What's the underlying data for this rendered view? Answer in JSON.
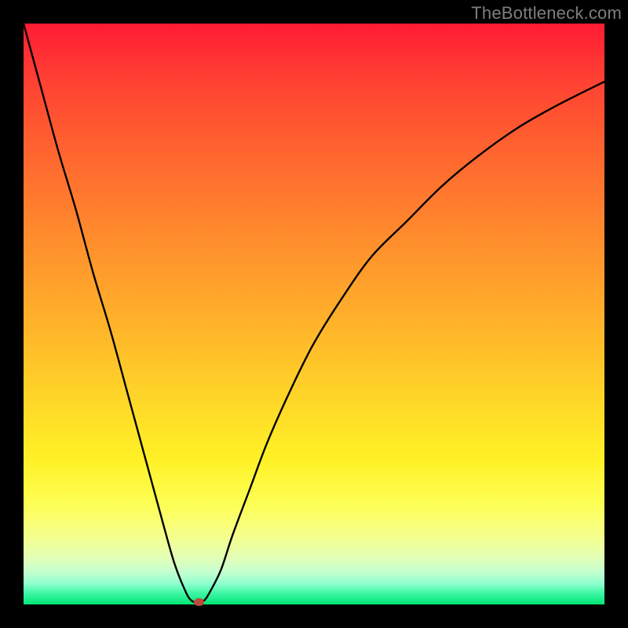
{
  "watermark": "TheBottleneck.com",
  "colors": {
    "frame": "#000000",
    "curve": "#000000",
    "marker": "#c0483f",
    "gradient_top": "#ff1b33",
    "gradient_bottom": "#00e676"
  },
  "chart_data": {
    "type": "line",
    "title": "",
    "xlabel": "",
    "ylabel": "",
    "xlim": [
      0,
      100
    ],
    "ylim": [
      0,
      100
    ],
    "grid": false,
    "legend": false,
    "series": [
      {
        "name": "bottleneck-curve",
        "x": [
          0,
          3,
          6,
          9,
          12,
          15,
          18,
          21,
          24,
          26,
          28,
          29,
          30,
          31,
          32,
          34,
          36,
          39,
          42,
          46,
          50,
          55,
          60,
          66,
          72,
          78,
          85,
          92,
          100
        ],
        "y": [
          100,
          89,
          78,
          68,
          57,
          47,
          36,
          25,
          14,
          7,
          2,
          0.6,
          0.3,
          0.6,
          2,
          6,
          12,
          20,
          28,
          37,
          45,
          53,
          60,
          66,
          72,
          77,
          82,
          86,
          90
        ]
      }
    ],
    "marker": {
      "x": 30.2,
      "y": 0.4
    }
  }
}
